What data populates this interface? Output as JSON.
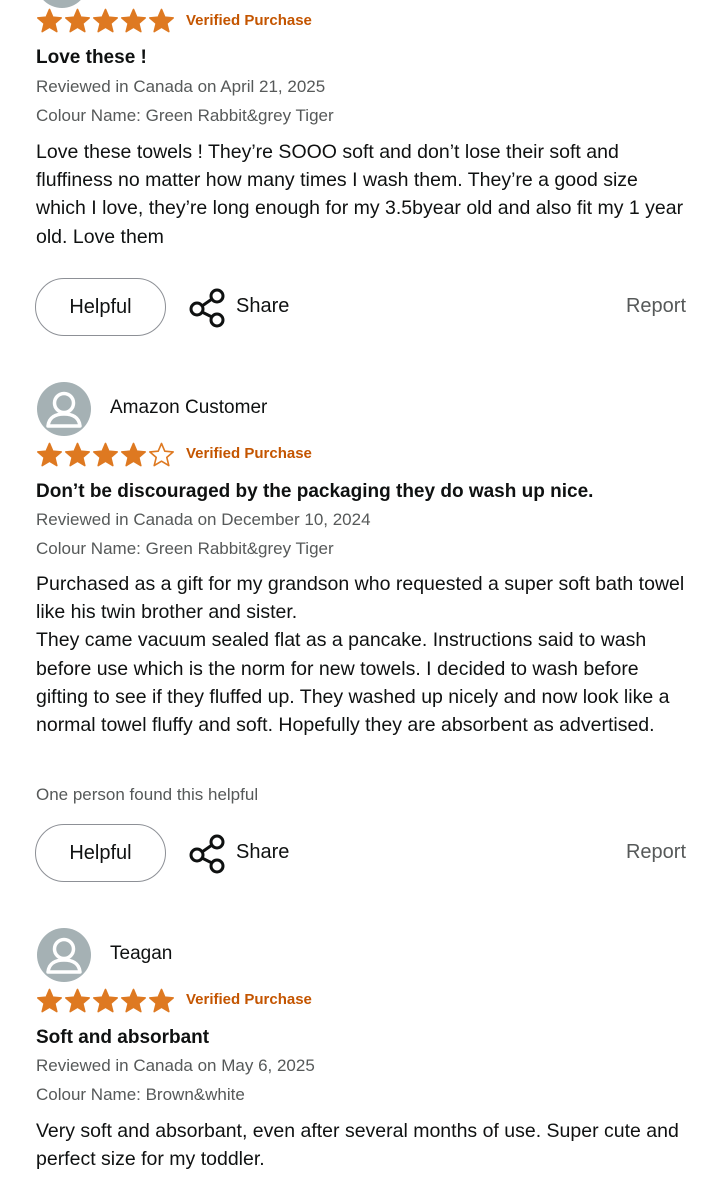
{
  "reviews": [
    {
      "reviewer": "",
      "rating": 5,
      "verified": "Verified Purchase",
      "title": "Love these !",
      "reviewed": "Reviewed in Canada on April 21, 2025",
      "colour": "Colour Name: Green Rabbit&grey Tiger",
      "body": "Love these towels ! They’re SOOO soft and don’t lose their soft and fluffiness no matter how many times I wash them. They’re a good size which I love, they’re long enough for my 3.5byear old and also fit my 1 year old. Love them",
      "helpful_note": "",
      "helpful_label": "Helpful",
      "share_label": "Share",
      "report_label": "Report"
    },
    {
      "reviewer": "Amazon Customer",
      "rating": 4,
      "verified": "Verified Purchase",
      "title": "Don’t be discouraged by the packaging they do wash up nice.",
      "reviewed": "Reviewed in Canada on December 10, 2024",
      "colour": "Colour Name: Green Rabbit&grey Tiger",
      "body": "Purchased as a gift for my grandson who requested a super soft bath towel like his twin brother and sister.\nThey came vacuum sealed flat as a pancake. Instructions said to wash before use which is the norm for new towels. I decided to wash before gifting to see if they fluffed up. They washed up nicely and now look like a normal towel fluffy and soft. Hopefully they are absorbent as advertised.",
      "helpful_note": "One person found this helpful",
      "helpful_label": "Helpful",
      "share_label": "Share",
      "report_label": "Report"
    },
    {
      "reviewer": "Teagan",
      "rating": 5,
      "verified": "Verified Purchase",
      "title": "Soft and absorbant",
      "reviewed": "Reviewed in Canada on May 6, 2025",
      "colour": "Colour Name: Brown&white",
      "body": "Very soft and absorbant, even after several months of use. Super cute and perfect size for my toddler."
    }
  ],
  "colors": {
    "star": "#de7921",
    "verified": "#c45500",
    "avatar": "#a5b1b4",
    "muted_text": "#565959",
    "text": "#0f1111"
  },
  "icons": {
    "star": "star-icon",
    "avatar": "user-silhouette-icon",
    "share": "share-icon"
  }
}
